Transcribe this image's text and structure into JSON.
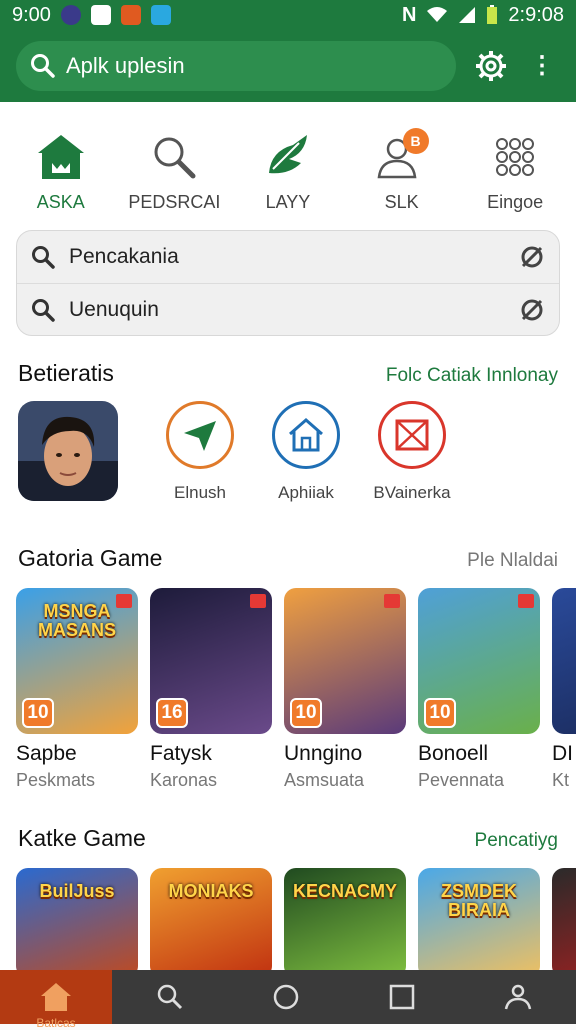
{
  "status": {
    "time_left": "9:00",
    "time_right": "2:9:08"
  },
  "search": {
    "placeholder": "Aplk uplesin"
  },
  "categories": [
    {
      "label": "ASKA",
      "icon": "home-icon",
      "active": true
    },
    {
      "label": "PEDSRCAI",
      "icon": "search-icon",
      "active": false
    },
    {
      "label": "LAYY",
      "icon": "leaf-icon",
      "active": false
    },
    {
      "label": "SLK",
      "icon": "person-icon",
      "active": false,
      "badge": "B"
    },
    {
      "label": "Eingoe",
      "icon": "grid-icon",
      "active": false
    }
  ],
  "recent_searches": [
    {
      "text": "Pencakania"
    },
    {
      "text": "Uenuquin"
    }
  ],
  "featured": {
    "title": "Betieratis",
    "link": "Folc Catiak Innlonay",
    "items": [
      {
        "label": "",
        "icon": "avatar"
      },
      {
        "label": "Elnush",
        "icon": "send-icon",
        "color": "#e07a2a"
      },
      {
        "label": "Aphiiak",
        "icon": "house-icon",
        "color": "#1f6fb5"
      },
      {
        "label": "BVainerka",
        "icon": "mail-icon",
        "color": "#d9362b"
      }
    ]
  },
  "section1": {
    "title": "Gatoria Game",
    "link": "Ple Nlaldai",
    "games": [
      {
        "name": "Sapbe",
        "sub": "Peskmats",
        "badge": "10",
        "art_text": "MSNGA MASANS",
        "c1": "#3aa0e8",
        "c2": "#f2a23a"
      },
      {
        "name": "Fatysk",
        "sub": "Karonas",
        "badge": "16",
        "art_text": "",
        "c1": "#1d1b3a",
        "c2": "#6a4a8a"
      },
      {
        "name": "Unngino",
        "sub": "Asmsuata",
        "badge": "10",
        "art_text": "",
        "c1": "#f0a040",
        "c2": "#5a3a7a"
      },
      {
        "name": "Bonoell",
        "sub": "Pevennata",
        "badge": "10",
        "art_text": "",
        "c1": "#4fa0d8",
        "c2": "#6ab04a"
      },
      {
        "name": "DI",
        "sub": "Kt",
        "badge": "",
        "art_text": "",
        "c1": "#2a4a9a",
        "c2": "#1a2a5a"
      }
    ]
  },
  "section2": {
    "title": "Katke Game",
    "link": "Pencatiyg",
    "games": [
      {
        "art_text": "BuilJuss",
        "c1": "#2a6ad0",
        "c2": "#c04a20"
      },
      {
        "art_text": "MONIAKS",
        "c1": "#f0a030",
        "c2": "#c03010"
      },
      {
        "art_text": "KECNACMY",
        "c1": "#204a20",
        "c2": "#80c040"
      },
      {
        "art_text": "ZSMDEK BIRAIA",
        "c1": "#4aa8e8",
        "c2": "#f0c060"
      },
      {
        "art_text": "",
        "c1": "#2a2a2a",
        "c2": "#aa2020"
      }
    ]
  },
  "navbar": {
    "items": [
      {
        "label": "Batlcas",
        "icon": "home-icon"
      },
      {
        "label": "",
        "icon": "search-icon"
      },
      {
        "label": "",
        "icon": "circle-icon"
      },
      {
        "label": "",
        "icon": "square-icon"
      },
      {
        "label": "",
        "icon": "people-icon"
      }
    ]
  }
}
